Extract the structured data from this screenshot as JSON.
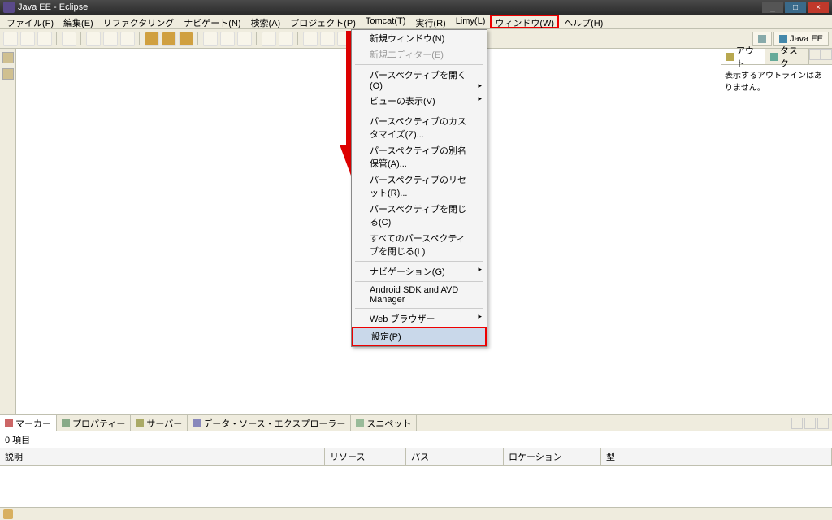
{
  "title": "Java EE - Eclipse",
  "menubar": [
    {
      "label": "ファイル(F)",
      "u": "F"
    },
    {
      "label": "編集(E)",
      "u": "E"
    },
    {
      "label": "リファクタリング",
      "u": ""
    },
    {
      "label": "ナビゲート(N)",
      "u": "N"
    },
    {
      "label": "検索(A)",
      "u": "A"
    },
    {
      "label": "プロジェクト(P)",
      "u": "P"
    },
    {
      "label": "Tomcat(T)",
      "u": "T"
    },
    {
      "label": "実行(R)",
      "u": "R"
    },
    {
      "label": "Limy(L)",
      "u": "L"
    },
    {
      "label": "ウィンドウ(W)",
      "u": "W",
      "open": true
    },
    {
      "label": "ヘルプ(H)",
      "u": "H"
    }
  ],
  "dropdown": [
    {
      "label": "新規ウィンドウ(N)",
      "type": "item"
    },
    {
      "label": "新規エディター(E)",
      "type": "item",
      "disabled": true
    },
    {
      "type": "sep"
    },
    {
      "label": "パースペクティブを開く(O)",
      "type": "sub"
    },
    {
      "label": "ビューの表示(V)",
      "type": "sub"
    },
    {
      "type": "sep"
    },
    {
      "label": "パースペクティブのカスタマイズ(Z)...",
      "type": "item"
    },
    {
      "label": "パースペクティブの別名保管(A)...",
      "type": "item"
    },
    {
      "label": "パースペクティブのリセット(R)...",
      "type": "item"
    },
    {
      "label": "パースペクティブを閉じる(C)",
      "type": "item"
    },
    {
      "label": "すべてのパースペクティブを閉じる(L)",
      "type": "item"
    },
    {
      "type": "sep"
    },
    {
      "label": "ナビゲーション(G)",
      "type": "sub"
    },
    {
      "type": "sep"
    },
    {
      "label": "Android SDK and AVD Manager",
      "type": "item"
    },
    {
      "type": "sep"
    },
    {
      "label": "Web ブラウザー",
      "type": "sub"
    },
    {
      "label": "設定(P)",
      "type": "item",
      "selected": true
    }
  ],
  "perspective_label": "Java EE",
  "right_tabs": {
    "outline": "アウト",
    "tasks": "タスク"
  },
  "right_body": "表示するアウトラインはありません。",
  "bottom_tabs": [
    "マーカー",
    "プロパティー",
    "サーバー",
    "データ・ソース・エクスプローラー",
    "スニペット"
  ],
  "bottom_count": "0 項目",
  "bottom_columns": {
    "desc": "説明",
    "resource": "リソース",
    "path": "パス",
    "location": "ロケーション",
    "type": "型"
  }
}
